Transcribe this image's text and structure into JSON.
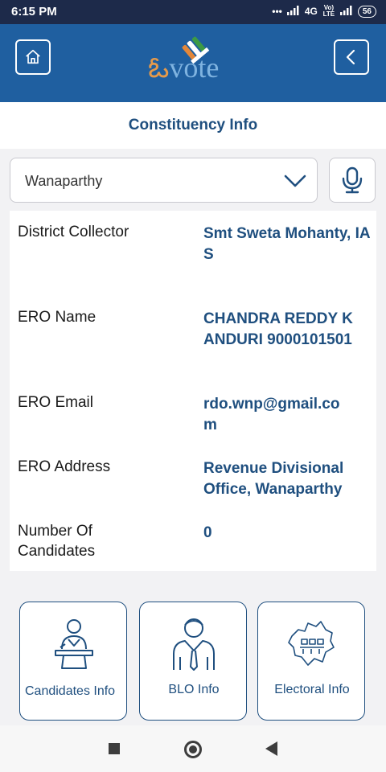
{
  "status_bar": {
    "time": "6:15 PM",
    "network_label": "4G",
    "volte_label": "Vo) LTE",
    "battery_level": "56"
  },
  "header": {
    "logo_text_accent": "ఓ",
    "logo_text": "vote",
    "colors": {
      "appbar": "#1f5fa0",
      "title": "#1f4f7f"
    }
  },
  "page": {
    "title": "Constituency Info"
  },
  "selector": {
    "selected": "Wanaparthy"
  },
  "info_rows": [
    {
      "label": "District Collector",
      "value": "Smt Sweta Mohanty, IAS"
    },
    {
      "label": "ERO Name",
      "value": "CHANDRA REDDY KANDURI 9000101501"
    },
    {
      "label": "ERO Email",
      "value": "rdo.wnp@gmail.com"
    },
    {
      "label": "ERO Address",
      "value": "Revenue Divisional Office, Wanaparthy"
    },
    {
      "label": "Number Of Candidates",
      "value": "0"
    }
  ],
  "cards": [
    {
      "label": "Candidates Info",
      "icon": "speaker-podium-icon"
    },
    {
      "label": "BLO Info",
      "icon": "officer-icon"
    },
    {
      "label": "Electoral Info",
      "icon": "state-map-icon"
    }
  ]
}
